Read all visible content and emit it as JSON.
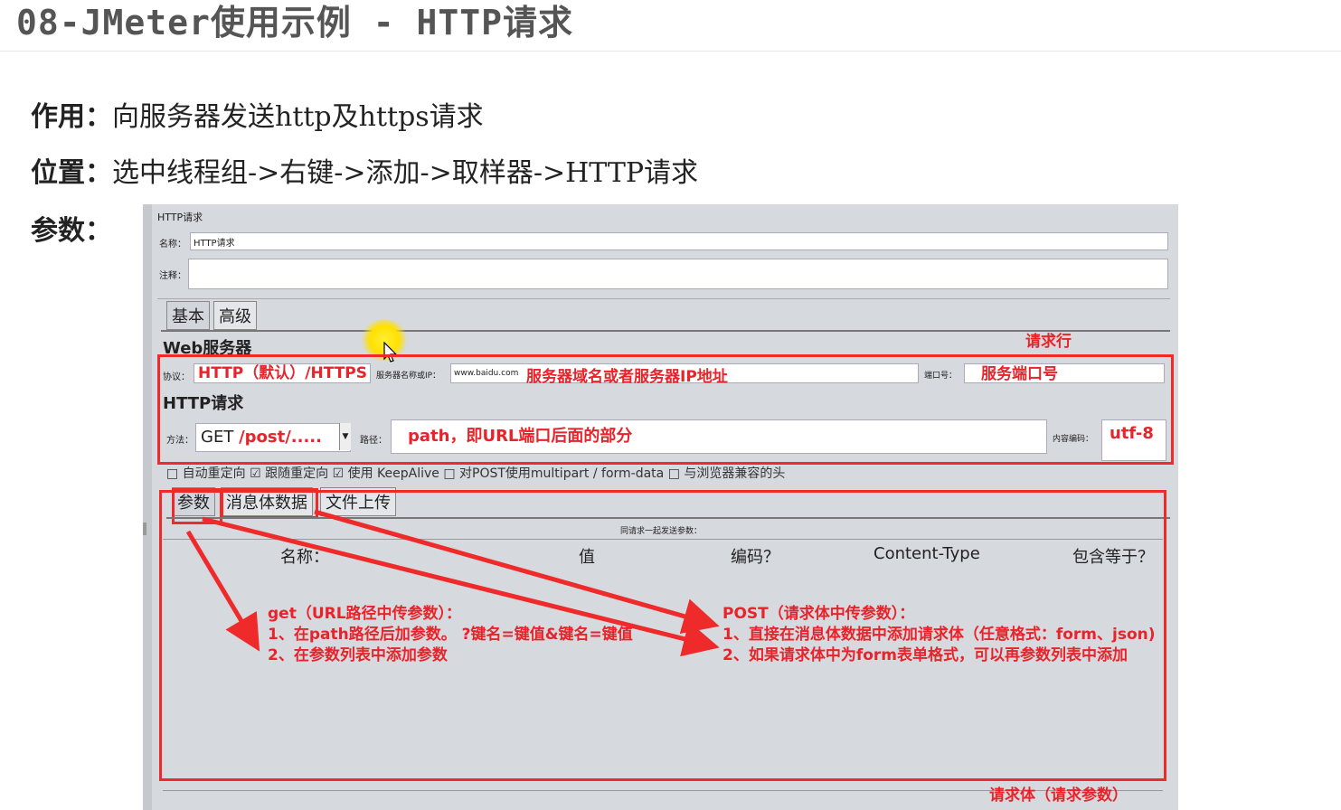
{
  "slide": {
    "title": "08-JMeter使用示例 - HTTP请求",
    "purpose_label": "作用：",
    "purpose_text": "向服务器发送http及https请求",
    "location_label": "位置：",
    "location_text": "选中线程组->右键->添加->取样器->HTTP请求",
    "params_label": "参数："
  },
  "jmeter": {
    "panel_title": "HTTP请求",
    "name_label": "名称：",
    "name_value": "HTTP请求",
    "comment_label": "注释：",
    "tabs": [
      "基本",
      "高级"
    ],
    "web_server_header": "Web服务器",
    "protocol_label": "协议：",
    "protocol_value": "HTTP（默认）/HTTPS",
    "server_label": "服务器名称或IP：",
    "server_value": "www.baidu.com",
    "server_note": "服务器域名或者服务器IP地址",
    "port_label": "端口号：",
    "port_value": "服务端口号",
    "http_request_header": "HTTP请求",
    "method_label": "方法：",
    "method_value": "GET",
    "method_note": "/post/.....",
    "path_label": "路径：",
    "path_value": "path，即URL端口后面的部分",
    "encoding_label": "内容编码：",
    "encoding_value": "utf-8",
    "options": "□ 自动重定向 ☑ 跟随重定向 ☑ 使用 KeepAlive □ 对POST使用multipart / form-data □ 与浏览器兼容的头",
    "body_tabs": [
      "参数",
      "消息体数据",
      "文件上传"
    ],
    "send_params_caption": "同请求一起发送参数：",
    "columns": [
      "名称：",
      "值",
      "编码？",
      "Content-Type",
      "包含等于？"
    ]
  },
  "annotations": {
    "request_line": "请求行",
    "request_body": "请求体（请求参数）",
    "get_title": "get（URL路径中传参数）：",
    "get_1": "1、在path路径后加参数。 ?键名=键值&键名=键值",
    "get_2": "2、在参数列表中添加参数",
    "post_title": "POST（请求体中传参数）：",
    "post_1": "1、直接在消息体数据中添加请求体（任意格式：form、json)",
    "post_2": "2、如果请求体中为form表单格式，可以再参数列表中添加"
  },
  "colors": {
    "annotation_red": "#e8232a",
    "panel_bg": "#d6d9de"
  }
}
